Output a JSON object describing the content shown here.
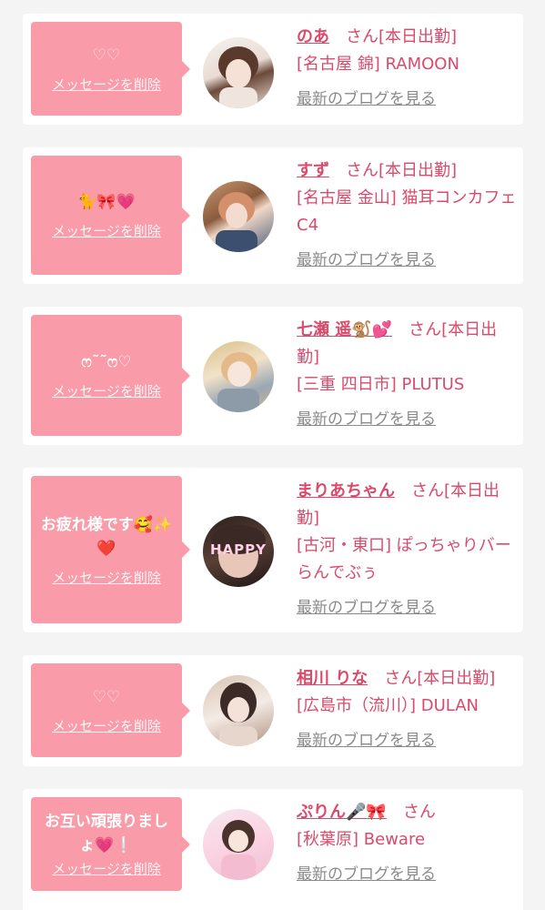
{
  "cards": [
    {
      "message": "♡♡",
      "delete_label": "メッセージを削除",
      "name": "のあ",
      "san": "さん",
      "status": "[本日出勤]",
      "shop": "[名古屋 錦] RAMOON",
      "blog_label": "最新のブログを見る"
    },
    {
      "message": "🐈🎀💗",
      "delete_label": "メッセージを削除",
      "name": "すず",
      "san": "さん",
      "status": "[本日出勤]",
      "shop": "[名古屋 金山] 猫耳コンカフェ C4",
      "blog_label": "最新のブログを見る"
    },
    {
      "message": "ෆ˜˜ෆ♡",
      "delete_label": "メッセージを削除",
      "name": "七瀬 遥🐒💕",
      "san": "さん",
      "status": "[本日出勤]",
      "shop": "[三重 四日市] PLUTUS",
      "blog_label": "最新のブログを見る"
    },
    {
      "message": "お疲れ様です🥰✨❤️",
      "delete_label": "メッセージを削除",
      "name": "まりあちゃん",
      "san": "さん",
      "status": "[本日出勤]",
      "shop": "[古河・東口] ぽっちゃりバー らんでぶぅ",
      "blog_label": "最新のブログを見る",
      "avatar_text": "HAPPY"
    },
    {
      "message": "♡♡",
      "delete_label": "メッセージを削除",
      "name": "相川 りな",
      "san": "さん",
      "status": "[本日出勤]",
      "shop": "[広島市（流川）] DULAN",
      "blog_label": "最新のブログを見る"
    },
    {
      "message": "お互い頑張りましょ💗❕",
      "delete_label": "メッセージを削除",
      "name": "ぷりん🎤🎀",
      "san": "さん",
      "status": "",
      "shop": "[秋葉原] Beware",
      "blog_label": "最新のブログを見る"
    }
  ],
  "colors": {
    "bubble": "#f99ba9",
    "accent": "#d94a6b",
    "link_gray": "#8a8a8a",
    "background": "#f4f4f4"
  }
}
